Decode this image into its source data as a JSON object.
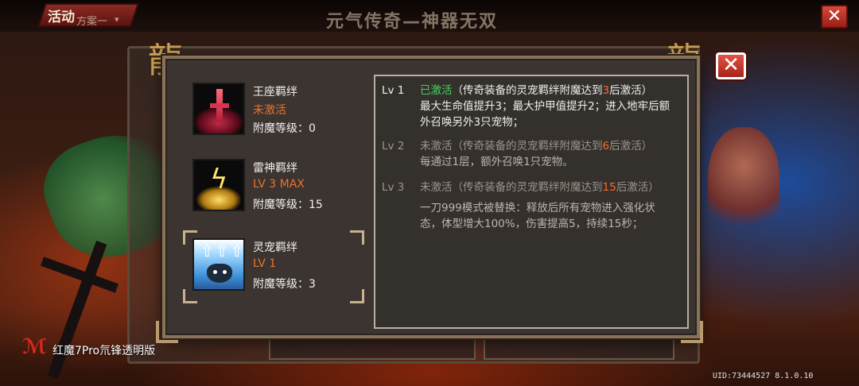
{
  "topbar": {
    "activity_label": "活动",
    "scheme_label": "方案一",
    "scheme_caret": "▾",
    "page_title": "元气传奇—神器无双",
    "close_glyph": "✕"
  },
  "dialog": {
    "close_glyph": "✕",
    "bonds": [
      {
        "name": "王座羁绊",
        "status": "未激活",
        "level_text": "附魔等级：0",
        "icon": "throne-sword-icon"
      },
      {
        "name": "雷神羁绊",
        "status": "LV 3 MAX",
        "level_text": "附魔等级：15",
        "icon": "thunder-icon"
      },
      {
        "name": "灵宠羁绊",
        "status": "LV 1",
        "level_text": "附魔等级：3",
        "icon": "pet-icon"
      }
    ],
    "tiers": [
      {
        "lv": "Lv 1",
        "state": "已激活",
        "cond_pre": "（传奇装备的灵宠羁绊附魔达到",
        "cond_num": "3",
        "cond_post": "后激活）",
        "desc": "最大生命值提升3；最大护甲值提升2；进入地牢后额外召唤另外3只宠物；"
      },
      {
        "lv": "Lv 2",
        "state": "未激活",
        "cond_pre": "（传奇装备的灵宠羁绊附魔达到",
        "cond_num": "6",
        "cond_post": "后激活）",
        "desc": "每通过1层，额外召唤1只宠物。"
      },
      {
        "lv": "Lv 3",
        "state": "未激活",
        "cond_pre": "（传奇装备的灵宠羁绊附魔达到",
        "cond_num": "15",
        "cond_post": "后激活）",
        "desc": "一刀999模式被替换：释放后所有宠物进入强化状态，体型增大100%，伤害提高5，持续15秒；"
      }
    ]
  },
  "footer": {
    "brand_text": "红魔7Pro氘锋透明版",
    "uid_text": "UID:73444527 8.1.0.10"
  },
  "colors": {
    "accent_orange": "#e8732f",
    "active_green": "#48d060",
    "close_red": "#d84a3a"
  }
}
